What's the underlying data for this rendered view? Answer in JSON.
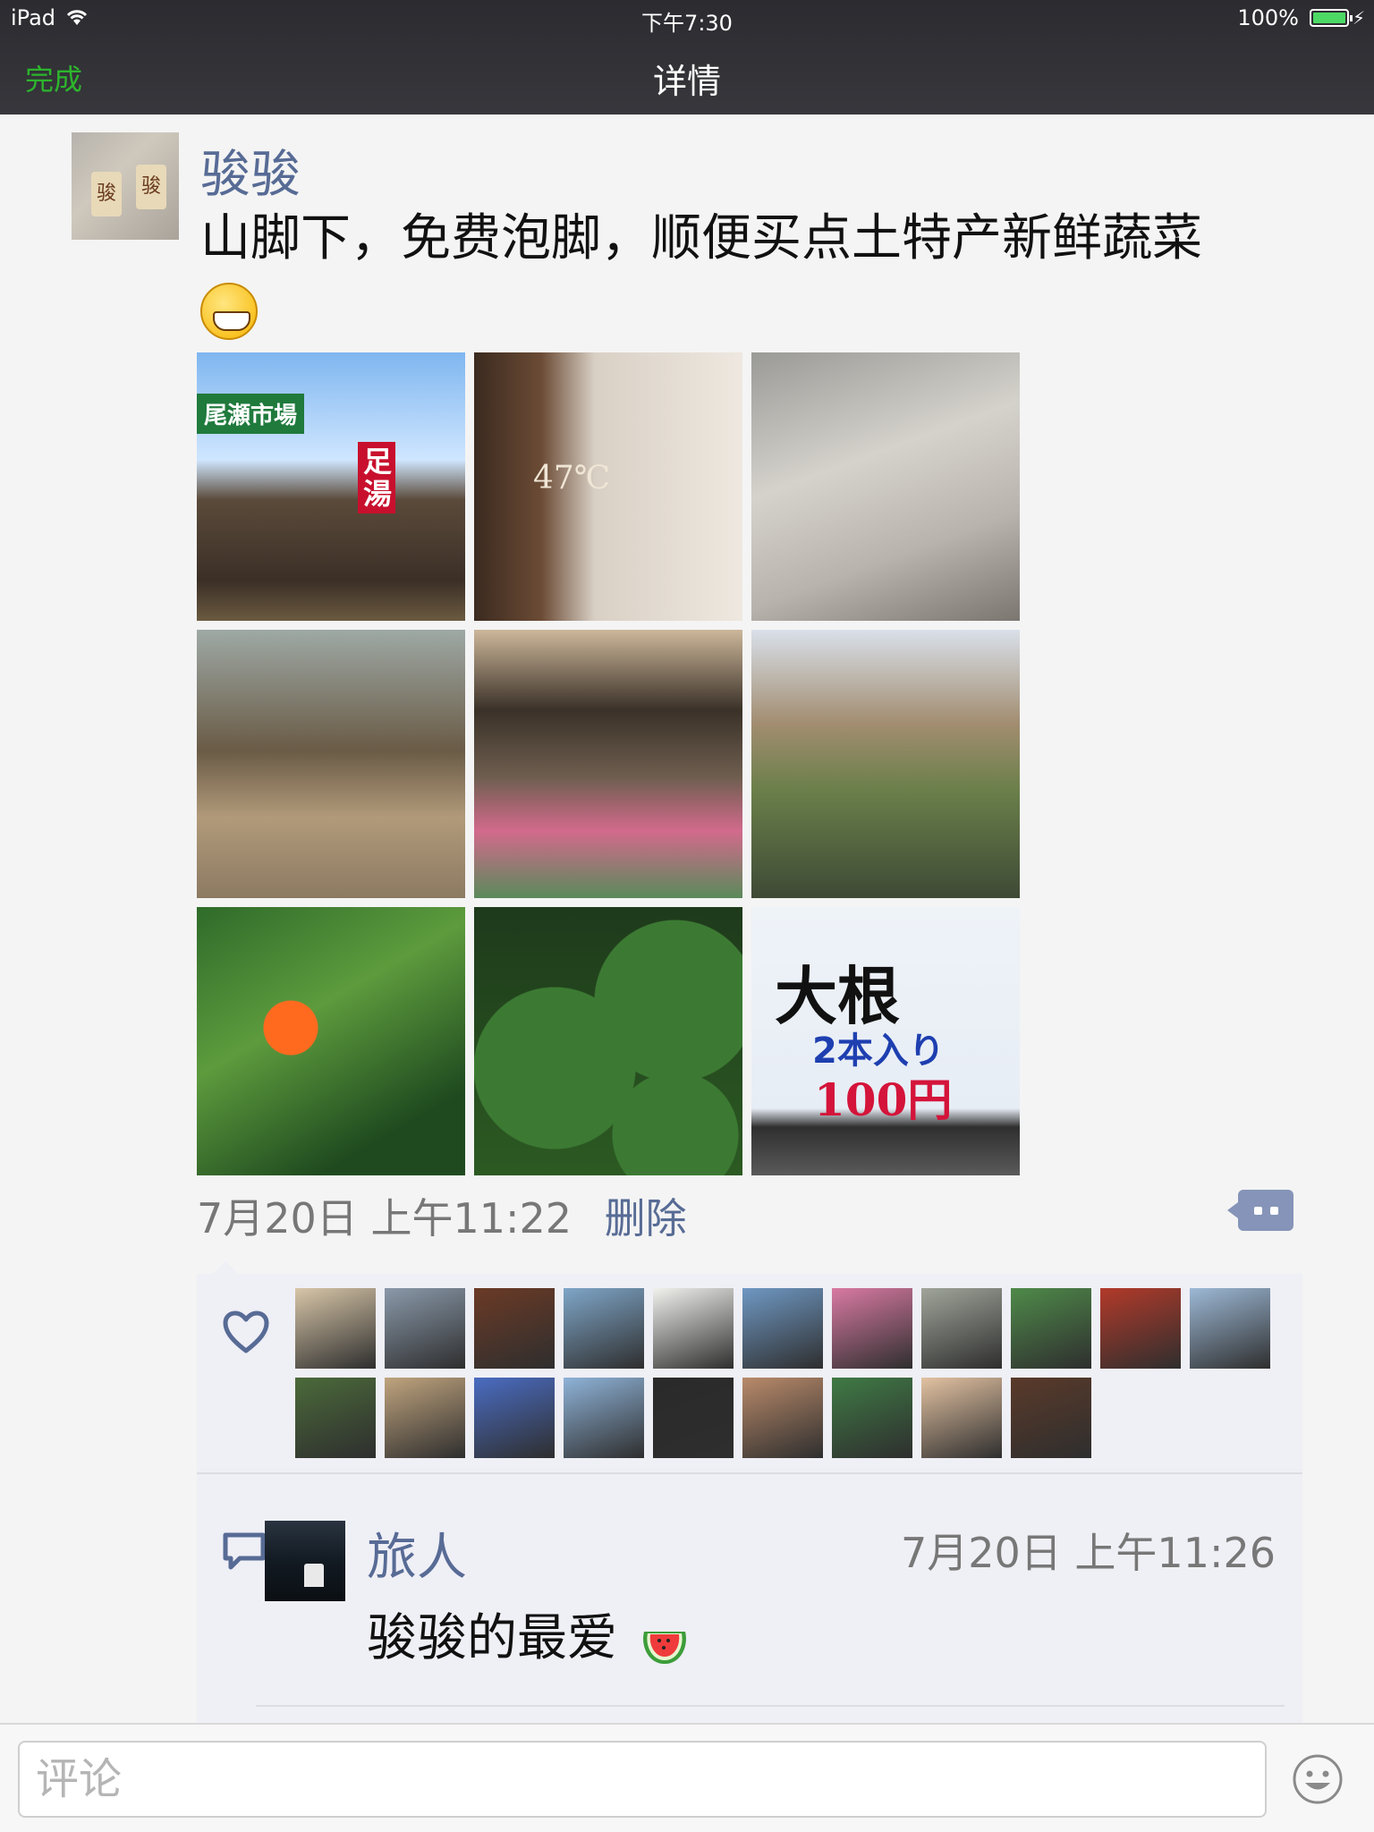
{
  "status_bar": {
    "device": "iPad",
    "time": "下午7:30",
    "battery": "100%"
  },
  "nav": {
    "done_label": "完成",
    "title": "详情"
  },
  "post": {
    "author": "骏骏",
    "avatar_chars": [
      "骏",
      "骏"
    ],
    "text": "山脚下，免费泡脚，顺便买点土特产新鲜蔬菜",
    "emoji": "grin-emoji",
    "photos": [
      {
        "id": 1,
        "sign_a": "尾瀬市場",
        "sign_b": "足湯"
      },
      {
        "id": 2,
        "sign": "47℃"
      },
      {
        "id": 3
      },
      {
        "id": 4
      },
      {
        "id": 5
      },
      {
        "id": 6
      },
      {
        "id": 7
      },
      {
        "id": 8
      },
      {
        "id": 9,
        "sign_1": "大根",
        "sign_2": "2本入り",
        "sign_3": "100円"
      }
    ],
    "date": "7月20日",
    "time": "上午11:22",
    "delete_label": "删除"
  },
  "likes": {
    "count": 20,
    "avatars": [
      {
        "color": "#d8c6a8"
      },
      {
        "color": "#8a99aa"
      },
      {
        "color": "#6b3a26"
      },
      {
        "color": "#7fa6c8"
      },
      {
        "color": "#f1f1ee"
      },
      {
        "color": "#6f98c3"
      },
      {
        "color": "#d97aa3"
      },
      {
        "color": "#a0a59a"
      },
      {
        "color": "#4f8a4a"
      },
      {
        "color": "#b23a2a"
      },
      {
        "color": "#9db9d6"
      },
      {
        "color": "#4b6a3a"
      },
      {
        "color": "#c0a47e"
      },
      {
        "color": "#4a6cc2"
      },
      {
        "color": "#8fb3d8"
      },
      {
        "color": "#2a2a2a"
      },
      {
        "color": "#b98a6a"
      },
      {
        "color": "#3f7a45"
      },
      {
        "color": "#e3c2a2"
      },
      {
        "color": "#5a3a2a"
      }
    ]
  },
  "comment": {
    "name": "旅人",
    "date": "7月20日",
    "time": "上午11:26",
    "text": "骏骏的最爱",
    "emoji": "watermelon-emoji"
  },
  "input": {
    "placeholder": "评论"
  }
}
